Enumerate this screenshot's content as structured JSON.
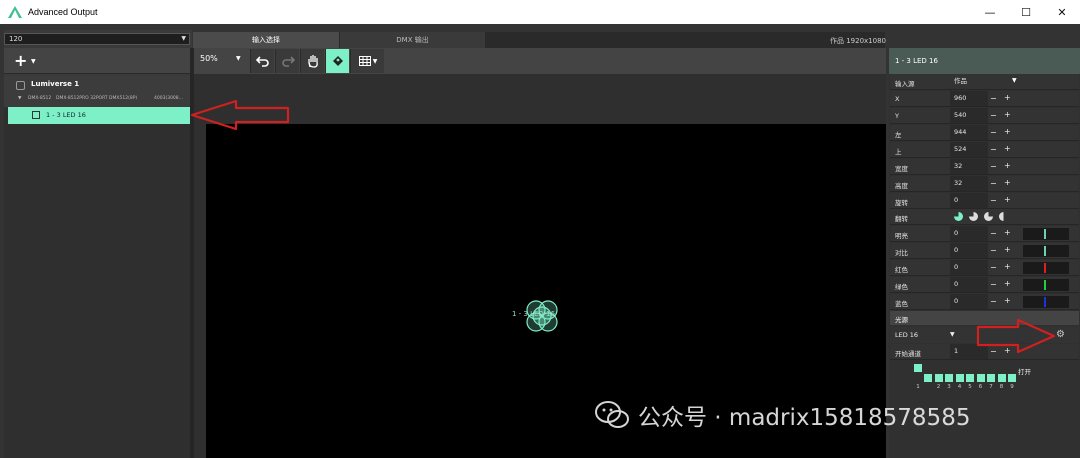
{
  "window": {
    "title": "Advanced Output",
    "minimize": "—",
    "maximize": "☐",
    "close": "✕"
  },
  "left_panel": {
    "preset": "120",
    "add_label": "+",
    "device": {
      "name": "Lumiverse 1",
      "model": "DMX-8512",
      "port": "DMX-8512PRO 32PORT DMX512(8P)",
      "info": "4003(3008..."
    },
    "fixture": {
      "label": "1 - 3 LED 16"
    }
  },
  "tabs": {
    "input": "输入选择",
    "dmx": "DMX 输出",
    "canvas_size": "作品 1920x1080"
  },
  "toolbar": {
    "zoom": "50%"
  },
  "canvas": {
    "node_label": "1 - 3 LED 16"
  },
  "props": {
    "header": "1 - 3 LED 16",
    "input_source": {
      "label": "输入源",
      "value": "作品"
    },
    "rows": [
      {
        "label": "X",
        "value": "960"
      },
      {
        "label": "Y",
        "value": "540"
      },
      {
        "label": "左",
        "value": "944"
      },
      {
        "label": "上",
        "value": "524"
      },
      {
        "label": "宽度",
        "value": "32"
      },
      {
        "label": "高度",
        "value": "32"
      },
      {
        "label": "旋转",
        "value": "0"
      }
    ],
    "flip_label": "翻转",
    "adjust": [
      {
        "label": "明亮",
        "value": "0",
        "color": "#6fd0b0"
      },
      {
        "label": "对比",
        "value": "0",
        "color": "#6fd0b0"
      },
      {
        "label": "红色",
        "value": "0",
        "color": "#e02020"
      },
      {
        "label": "绿色",
        "value": "0",
        "color": "#20d040"
      },
      {
        "label": "蓝色",
        "value": "0",
        "color": "#2030e0"
      }
    ],
    "minus": "−",
    "plus": "+",
    "light_source": {
      "title": "光源",
      "fixture": "LED 16"
    },
    "start_channel": {
      "label": "开始通道",
      "value": "1"
    },
    "channels": [
      "1",
      "2",
      "3",
      "4",
      "5",
      "6",
      "7",
      "8",
      "9"
    ],
    "open_label": "打开"
  },
  "watermark": "公众号 · madrix15818578585",
  "colors": {
    "accent": "#7ef0c8",
    "annotation": "#d02020"
  }
}
